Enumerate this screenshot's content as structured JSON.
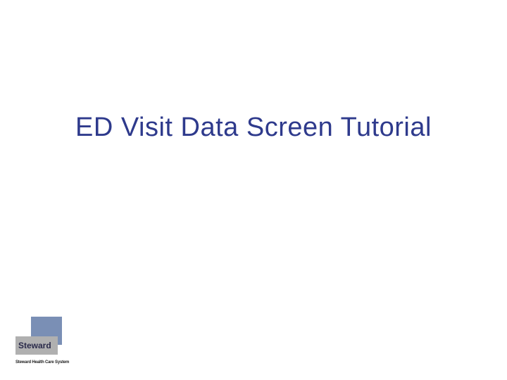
{
  "title": "ED Visit Data Screen Tutorial",
  "logo": {
    "brand": "Steward",
    "subtext": "Steward Health Care System"
  }
}
